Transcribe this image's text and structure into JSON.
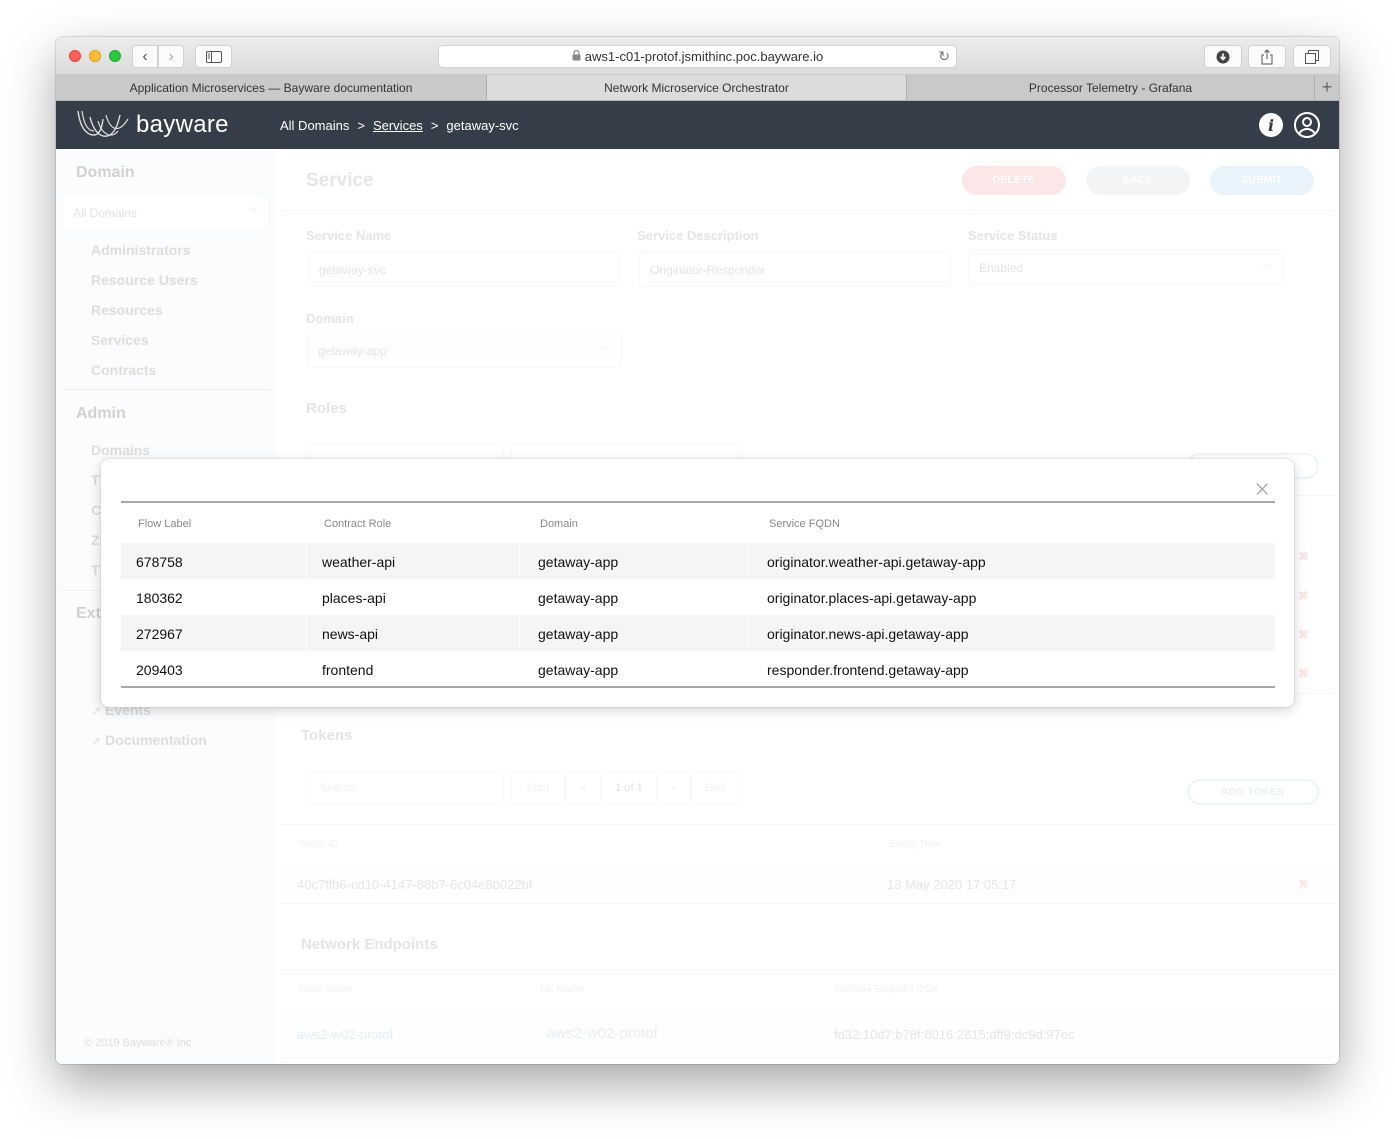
{
  "browser": {
    "url": "aws1-c01-protof.jsmithinc.poc.bayware.io",
    "tabs": [
      {
        "label": "Application Microservices — Bayware documentation",
        "active": false
      },
      {
        "label": "Network Microservice Orchestrator",
        "active": true
      },
      {
        "label": "Processor Telemetry - Grafana",
        "active": false
      }
    ],
    "icons": {
      "back": "‹",
      "forward": "›",
      "reload": "↻",
      "lock": "🔒",
      "download": "⬇",
      "share": "⇧",
      "tabs": "❐",
      "new_tab": "+"
    }
  },
  "app": {
    "logo_text": "bayware",
    "breadcrumb": {
      "root": "All Domains",
      "sep": ">",
      "section": "Services",
      "current": "getaway-svc"
    },
    "info_icon": "i"
  },
  "sidebar": {
    "domain_heading": "Domain",
    "domain_select": {
      "value": "All Domains"
    },
    "domain_items": [
      "Administrators",
      "Resource Users",
      "Resources",
      "Services",
      "Contracts"
    ],
    "admin_heading": "Admin",
    "admin_items_visible": [
      "Domains",
      "T",
      "C",
      "Z",
      "T"
    ],
    "external_heading_visible": "Ext",
    "external_items": [
      "Events",
      "Documentation"
    ],
    "copyright": "© 2019 Bayware® Inc."
  },
  "service": {
    "title": "Service",
    "buttons": {
      "delete": "DELETE",
      "back": "BACK",
      "submit": "SUBMIT"
    },
    "fields": {
      "name_label": "Service Name",
      "name_value": "getaway-svc",
      "description_label": "Service Description",
      "description_value": "Originator-Responder",
      "status_label": "Service Status",
      "status_value": "Enabled",
      "domain_label": "Domain",
      "domain_value": "getaway-app"
    },
    "roles_title": "Roles",
    "tokens": {
      "title": "Tokens",
      "search_placeholder": "Search",
      "pager": {
        "start": "Start",
        "prev": "«",
        "page": "1 of 1",
        "next": "»",
        "end": "End"
      },
      "add_button": "ADD TOKEN",
      "columns": [
        "Token ID",
        "Expiry Time"
      ],
      "rows": [
        {
          "token_id": "40c7ffb6-cd10-4147-88b7-6c04e8b022bf",
          "expiry": "13 May 2020 17:05:17"
        }
      ]
    },
    "endpoints": {
      "title": "Network Endpoints",
      "columns": [
        "Node Name",
        "NE Name",
        "Network Endpoint CGA"
      ],
      "rows": [
        {
          "node": "aws2-w02-protof",
          "ne": "aws2-w02-protof",
          "cga": "fd32:10d7:b78f:8016:2815:dff9:dc9d:97ec"
        }
      ]
    }
  },
  "modal": {
    "close_icon": "×",
    "columns": [
      "Flow Label",
      "Contract Role",
      "Domain",
      "Service FQDN"
    ],
    "rows": [
      {
        "flow_label": "678758",
        "role": "weather-api",
        "domain": "getaway-app",
        "fqdn": "originator.weather-api.getaway-app"
      },
      {
        "flow_label": "180362",
        "role": "places-api",
        "domain": "getaway-app",
        "fqdn": "originator.places-api.getaway-app"
      },
      {
        "flow_label": "272967",
        "role": "news-api",
        "domain": "getaway-app",
        "fqdn": "originator.news-api.getaway-app"
      },
      {
        "flow_label": "209403",
        "role": "frontend",
        "domain": "getaway-app",
        "fqdn": "responder.frontend.getaway-app"
      }
    ]
  },
  "colors": {
    "header_bg": "#343d48",
    "delete": "#f8c7cb",
    "submit": "#cfe5f5",
    "remove_x": "#f6c9c9"
  }
}
